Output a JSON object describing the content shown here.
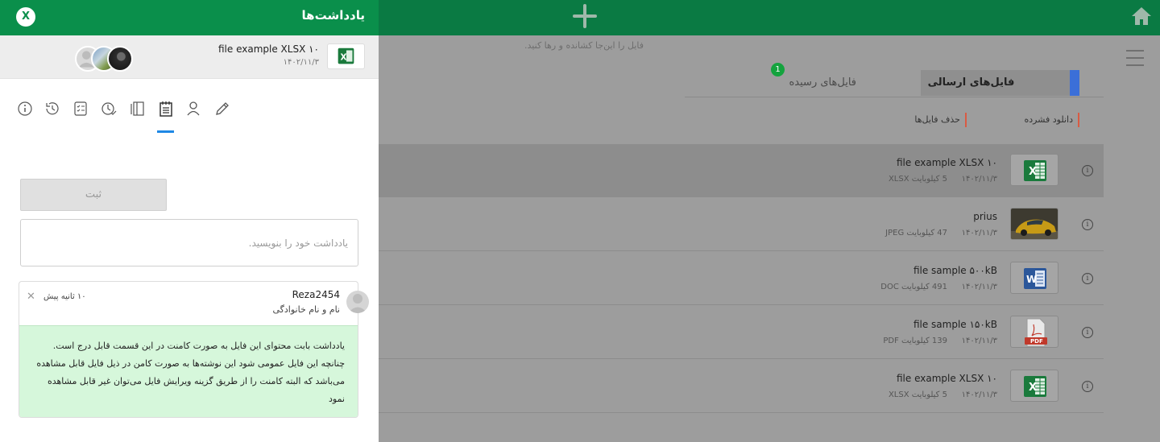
{
  "app": {
    "drop_hint": "فایل را این‌جا کشانده و رها کنید.",
    "tabs": [
      {
        "label": "فایل‌های ارسالی",
        "active": true
      },
      {
        "label": "فایل‌های رسیده",
        "badge": "1"
      }
    ],
    "actions": {
      "download": "دانلود فشرده",
      "delete": "حذف فایل‌ها"
    },
    "files": [
      {
        "name": "file example XLSX ۱۰",
        "date": "۱۴۰۲/۱۱/۳",
        "size": "5 کیلوبایت XLSX",
        "type": "xlsx",
        "icon": "excel-icon",
        "selected": true
      },
      {
        "name": "prius",
        "date": "۱۴۰۲/۱۱/۳",
        "size": "47 کیلوبایت JPEG",
        "type": "jpeg",
        "icon": "image-thumbnail"
      },
      {
        "name": "file sample ۵۰۰kB",
        "date": "۱۴۰۲/۱۱/۳",
        "size": "491 کیلوبایت DOC",
        "type": "doc",
        "icon": "word-icon"
      },
      {
        "name": "file sample ۱۵۰kB",
        "date": "۱۴۰۲/۱۱/۳",
        "size": "139 کیلوبایت PDF",
        "type": "pdf",
        "icon": "pdf-icon"
      },
      {
        "name": "file example XLSX ۱۰",
        "date": "۱۴۰۲/۱۱/۳",
        "size": "5 کیلوبایت XLSX",
        "type": "xlsx",
        "icon": "excel-icon"
      }
    ]
  },
  "panel": {
    "title": "یادداشت‌ها",
    "close_label": "X",
    "file": {
      "name": "file example XLSX ۱۰",
      "date": "۱۴۰۲/۱۱/۳"
    },
    "tools": [
      "edit-icon",
      "user-icon",
      "notes-icon",
      "versions-icon",
      "time-check-icon",
      "checklist-icon",
      "history-icon",
      "info-icon"
    ],
    "active_tool": "notes-icon",
    "submit_label": "ثبت",
    "input_placeholder": "یادداشت خود را بنویسید.",
    "comment": {
      "author": "Reza2454",
      "fullname": "نام و نام خانوادگی",
      "time": "۱۰ ثانیه پیش",
      "delete_label": "✕",
      "body": "یادداشت بابت محتوای این فایل به صورت کامنت در این قسمت قابل درج است. چنانچه این فایل عمومی شود این نوشته‌ها به صورت کامن در ذیل فایل قابل مشاهده می‌باشد که البته کامنت را از طریق گزینه ویرایش فایل می‌توان غیر قابل مشاهده نمود"
    }
  },
  "colors": {
    "header_green": "#0a8f4b",
    "tab_accent": "#3b6fd8",
    "action_marker": "#d95b43",
    "comment_bg": "#d6f7db",
    "active_tool": "#1e88e5"
  }
}
